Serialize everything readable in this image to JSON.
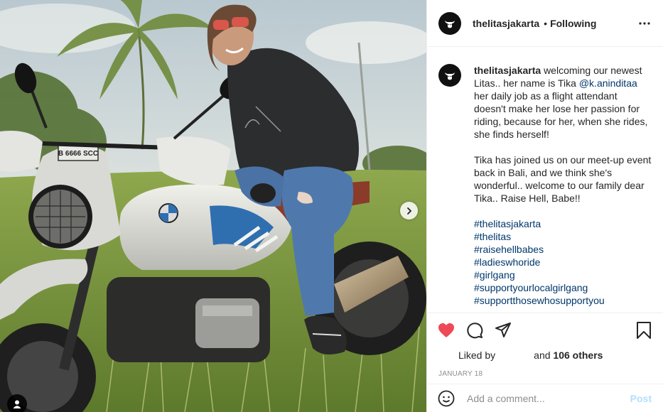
{
  "post": {
    "username": "thelitasjakarta",
    "follow_state": "Following",
    "header_separator": "•",
    "caption": {
      "username": "thelitasjakarta",
      "text_before_mention": "welcoming our newest Litas.. her name is Tika",
      "mention": "@k.aninditaa",
      "text_after_mention": "her daily job as a flight attendant doesn't make her lose her passion for riding, because for her, when she rides, she finds herself!",
      "paragraph2": "Tika has joined us on our meet-up event back in Bali, and we think she's wonderful.. welcome to our family dear Tika.. Raise Hell, Babe!!",
      "hashtags": [
        "#thelitasjakarta",
        "#thelitas",
        "#raisehellbabes",
        "#ladieswhoride",
        "#girlgang",
        "#supportyourlocalgirlgang",
        "#supportthosewhosupportyou"
      ]
    },
    "likes": {
      "liked_by_label": "Liked by",
      "and_label": "and",
      "others_label": "106 others"
    },
    "date": "JANUARY 18",
    "comment": {
      "placeholder": "Add a comment...",
      "post_label": "Post"
    },
    "photo": {
      "plate_text": "B 6666 SCC"
    },
    "colors": {
      "like_red": "#ed4956",
      "link_blue": "#00376b",
      "post_disabled": "#b2dffc",
      "muted": "#8e8e8e"
    },
    "icons": [
      "heart-icon",
      "comment-icon",
      "share-icon",
      "bookmark-icon",
      "more-icon",
      "emoji-icon",
      "chevron-right-icon",
      "user-tag-icon"
    ]
  }
}
